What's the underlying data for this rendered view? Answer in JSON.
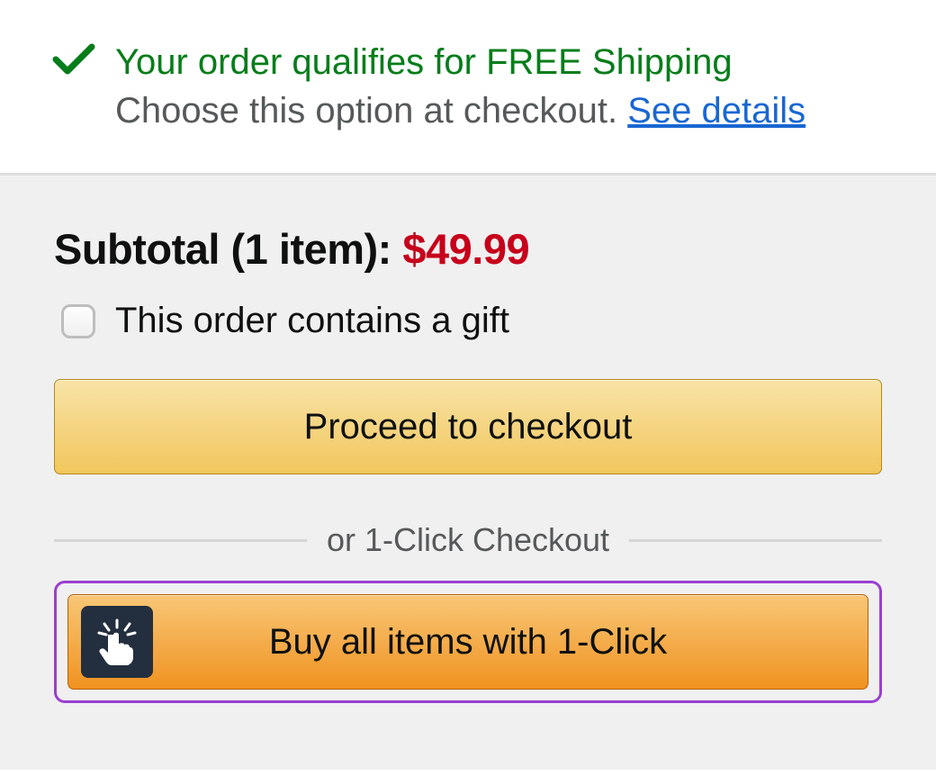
{
  "shipping": {
    "title": "Your order qualifies for FREE Shipping",
    "sub": "Choose this option at checkout. ",
    "details_link": "See details"
  },
  "subtotal": {
    "label": "Subtotal (1 item): ",
    "amount": "$49.99"
  },
  "gift": {
    "label": "This order contains a gift",
    "checked": false
  },
  "buttons": {
    "checkout": "Proceed to checkout",
    "one_click": "Buy all items with 1-Click"
  },
  "divider": {
    "label": "or 1-Click Checkout"
  },
  "colors": {
    "success": "#067d1a",
    "price": "#c7001b",
    "link": "#1967d2",
    "highlight_border": "#9a3fd1"
  }
}
